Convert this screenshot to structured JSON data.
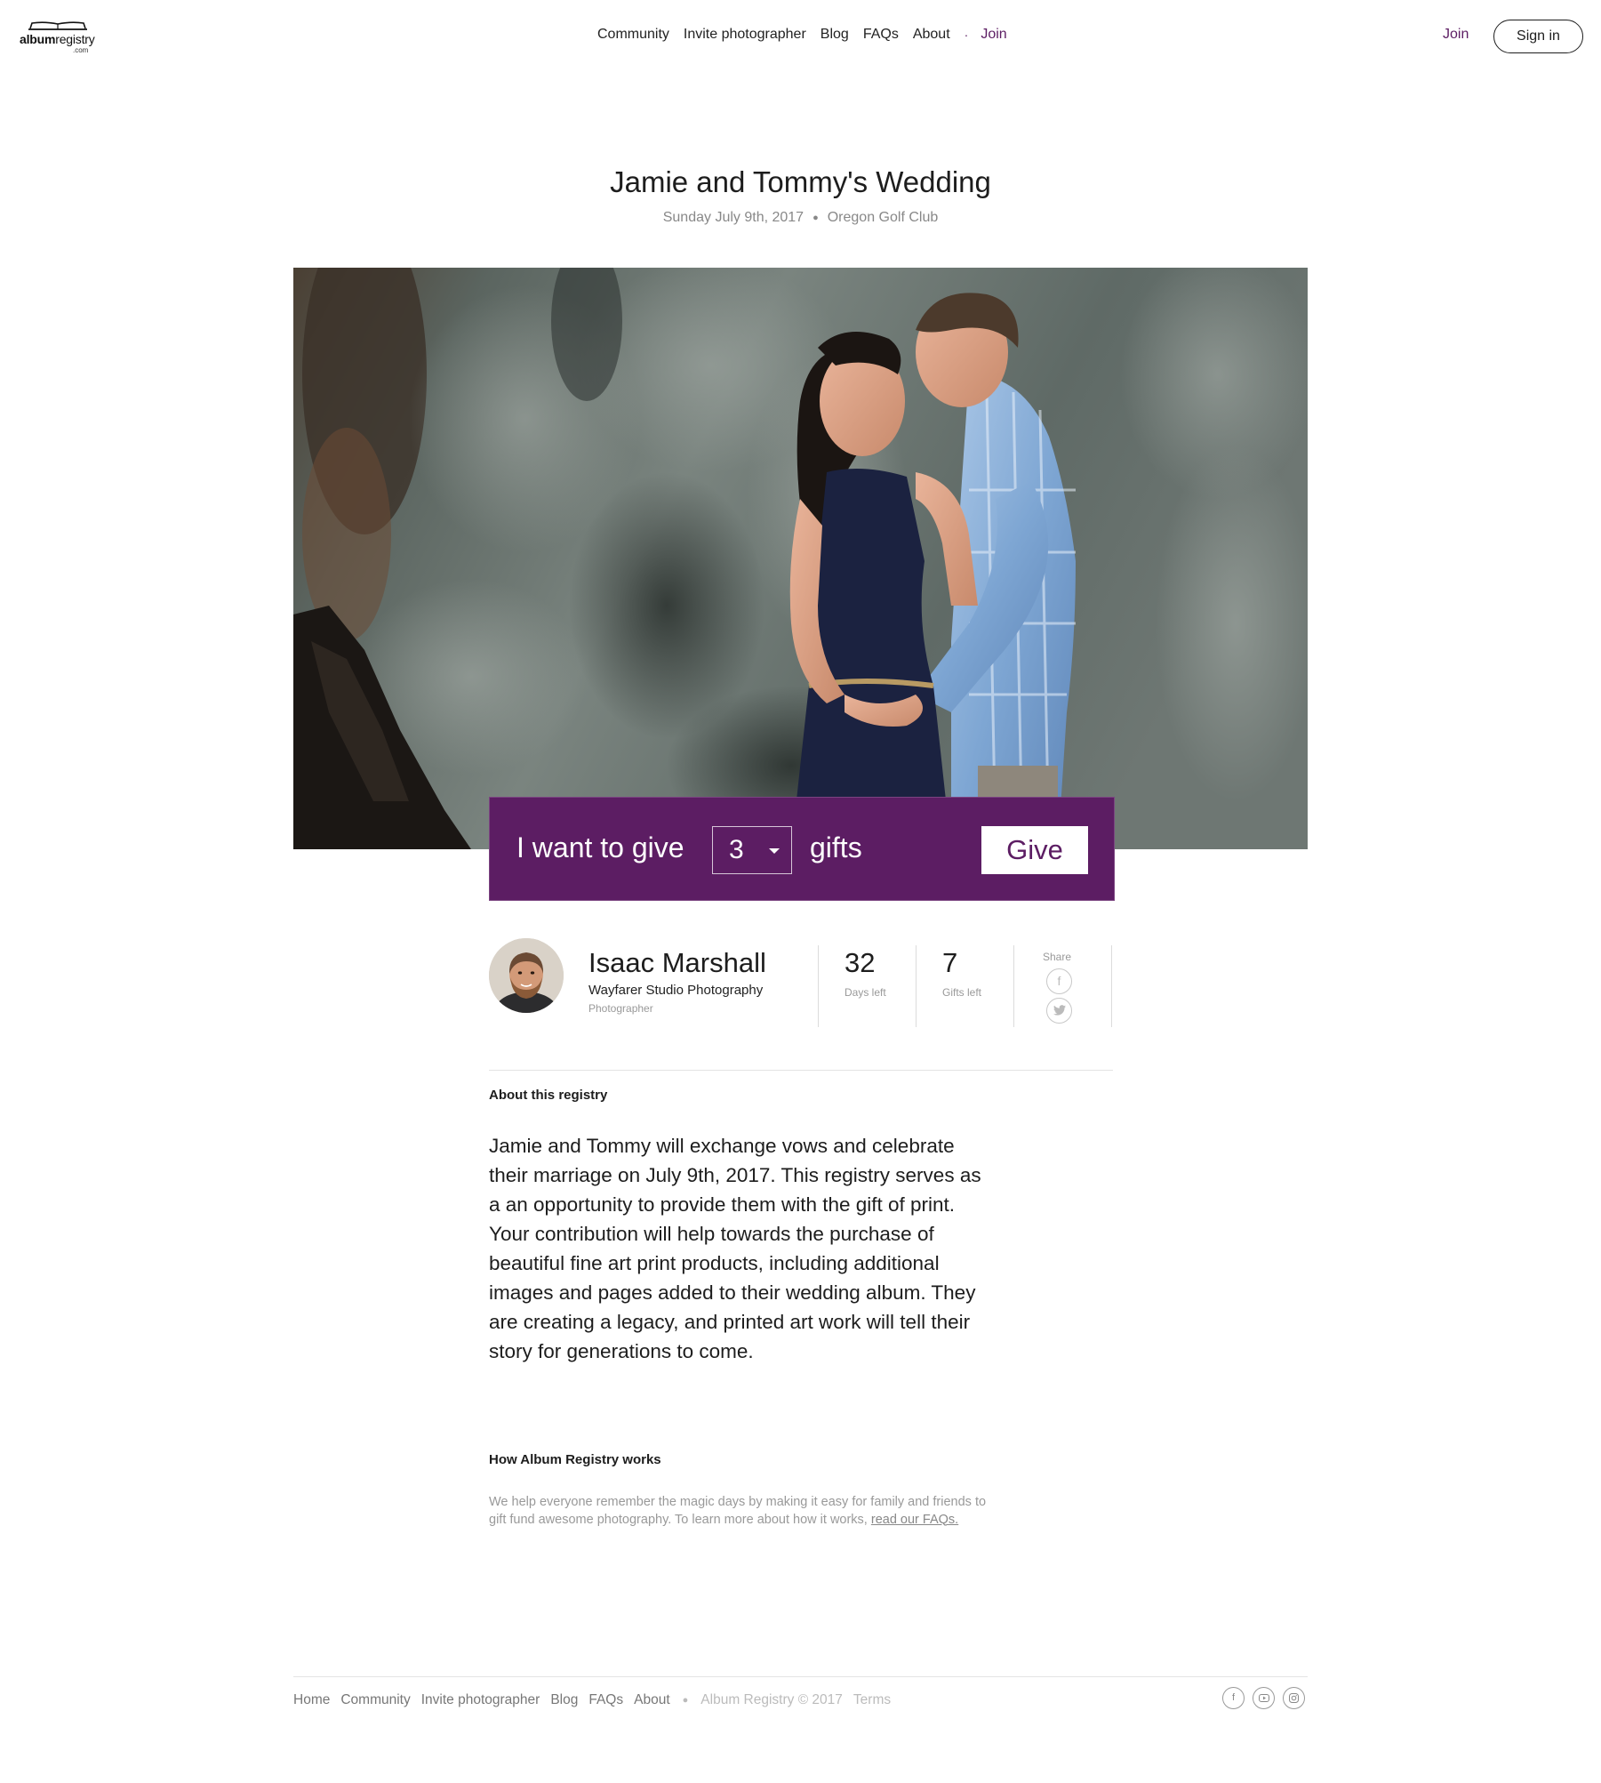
{
  "header": {
    "logo": {
      "main_bold": "album",
      "main_regular": "registry",
      "sub": ".com"
    },
    "nav": [
      "Community",
      "Invite photographer",
      "Blog",
      "FAQs",
      "About"
    ],
    "nav_join": "Join",
    "join_label": "Join",
    "signin_label": "Sign in",
    "accent_color": "#5c1d63"
  },
  "event": {
    "title": "Jamie and Tommy's Wedding",
    "date": "Sunday July 9th, 2017",
    "venue": "Oregon Golf Club"
  },
  "gift_bar": {
    "prefix": "I want to give",
    "quantity": "3",
    "suffix": "gifts",
    "button_label": "Give",
    "background_color": "#5c1d63"
  },
  "photographer": {
    "name": "Isaac Marshall",
    "studio": "Wayfarer Studio Photography",
    "role": "Photographer"
  },
  "stats": {
    "days_left": "32",
    "days_left_label": "Days left",
    "gifts_left": "7",
    "gifts_left_label": "Gifts left",
    "share_label": "Share",
    "share_icons": [
      "facebook-icon",
      "twitter-icon"
    ]
  },
  "about": {
    "heading": "About this registry",
    "body": "Jamie and Tommy will exchange vows and celebrate their marriage on July 9th, 2017. This registry serves as a an opportunity to provide them with the gift of print. Your contribution will help towards the purchase of beautiful fine art print products, including additional images and pages added to their wedding album. They are creating a legacy, and printed art work will tell their story for generations to come."
  },
  "how": {
    "heading": "How Album Registry works",
    "body": "We help everyone remember the magic days by making it easy for family and friends to gift fund awesome photography. To learn more about how it works, ",
    "link": "read our FAQs."
  },
  "footer": {
    "nav": [
      "Home",
      "Community",
      "Invite photographer",
      "Blog",
      "FAQs",
      "About"
    ],
    "copyright": "Album Registry © 2017",
    "terms": "Terms",
    "social_icons": [
      "facebook-icon",
      "youtube-icon",
      "instagram-icon"
    ]
  }
}
